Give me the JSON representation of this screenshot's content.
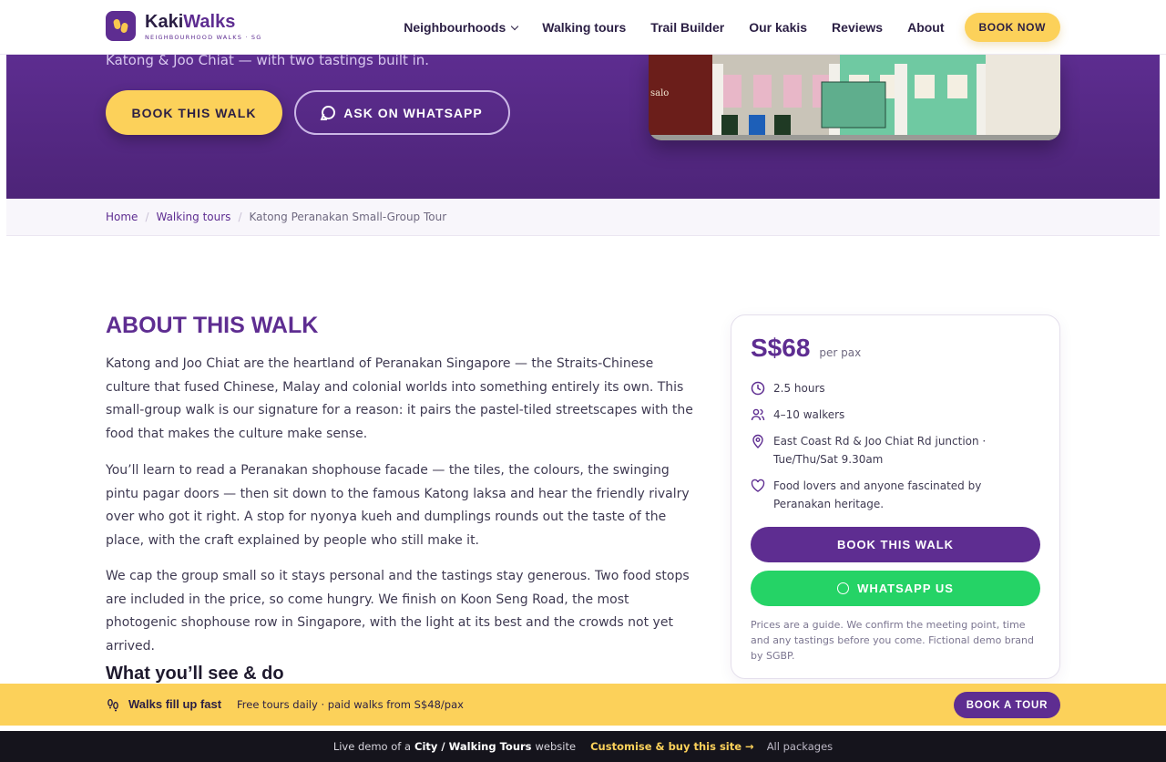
{
  "brand": {
    "name_part1": "Kaki",
    "name_part2": "Walks",
    "tagline": "NEIGHBOURHOOD WALKS · SG"
  },
  "nav": {
    "items": [
      "Neighbourhoods",
      "Walking tours",
      "Trail Builder",
      "Our kakis",
      "Reviews",
      "About"
    ],
    "cta": "BOOK NOW"
  },
  "hero": {
    "subtitle": "Katong & Joo Chiat — with two tastings built in.",
    "book_label": "BOOK THIS WALK",
    "whatsapp_label": "ASK ON WHATSAPP",
    "photo_sign": "salo"
  },
  "breadcrumb": {
    "home": "Home",
    "section": "Walking tours",
    "current": "Katong Peranakan Small-Group Tour"
  },
  "about": {
    "title": "ABOUT THIS WALK",
    "paragraphs": [
      "Katong and Joo Chiat are the heartland of Peranakan Singapore — the Straits-Chinese culture that fused Chinese, Malay and colonial worlds into something entirely its own. This small-group walk is our signature for a reason: it pairs the pastel-tiled streetscapes with the food that makes the culture make sense.",
      "You’ll learn to read a Peranakan shophouse facade — the tiles, the colours, the swinging pintu pagar doors — then sit down to the famous Katong laksa and hear the friendly rivalry over who got it right. A stop for nyonya kueh and dumplings rounds out the taste of the place, with the craft explained by people who still make it.",
      "We cap the group small so it stays personal and the tastings stay generous. Two food stops are included in the price, so come hungry. We finish on Koon Seng Road, the most photogenic shophouse row in Singapore, with the light at its best and the crowds not yet arrived."
    ],
    "subheading": "What you’ll see & do"
  },
  "card": {
    "price": "S$68",
    "per": "per pax",
    "duration": "2.5 hours",
    "group": "4–10 walkers",
    "meeting": "East Coast Rd & Joo Chiat Rd junction · Tue/Thu/Sat 9.30am",
    "audience": "Food lovers and anyone fascinated by Peranakan heritage.",
    "book_label": "BOOK THIS WALK",
    "whatsapp_label": "WHATSAPP US",
    "note": "Prices are a guide. We confirm the meeting point, time and any tastings before you come. Fictional demo brand by SGBP."
  },
  "sticky": {
    "title": "Walks fill up fast",
    "subtitle": "Free tours daily · paid walks from S$48/pax",
    "cta": "BOOK A TOUR"
  },
  "demo_bar": {
    "prefix": "Live demo of a",
    "site_type": "City / Walking Tours",
    "suffix": "website",
    "customise": "Customise & buy this site →",
    "packages": "All packages"
  },
  "colors": {
    "brand_purple": "#5e2d91",
    "accent_yellow": "#fcd15a",
    "whatsapp_green": "#25d366"
  }
}
